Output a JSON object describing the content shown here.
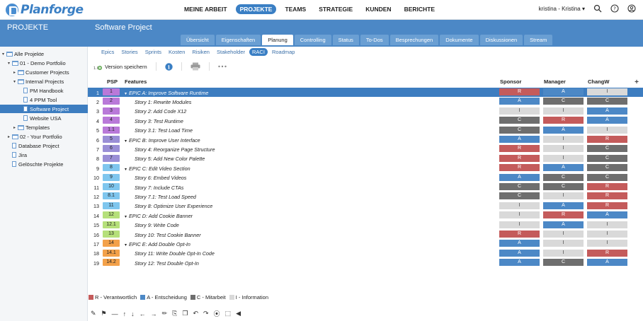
{
  "brand": {
    "name": "Planforge",
    "color": "#3a7fc4"
  },
  "mainnav": [
    "MEINE ARBEIT",
    "PROJEKTE",
    "TEAMS",
    "STRATEGIE",
    "KUNDEN",
    "BERICHTE"
  ],
  "mainnav_active": "PROJEKTE",
  "user": {
    "label": "kristina - Kristina ▾"
  },
  "topicons": [
    "search-icon",
    "help-icon",
    "user-icon"
  ],
  "sidebar": {
    "title": "PROJEKTE",
    "items": [
      {
        "label": "Alle Projekte",
        "type": "folder",
        "depth": 0,
        "caret": "▾"
      },
      {
        "label": "01 - Demo Portfolio",
        "type": "folder",
        "depth": 1,
        "caret": "▾"
      },
      {
        "label": "Customer Projects",
        "type": "folder",
        "depth": 2,
        "caret": "▸"
      },
      {
        "label": "Internal Projects",
        "type": "folder",
        "depth": 2,
        "caret": "▾"
      },
      {
        "label": "PM Handbook",
        "type": "doc",
        "depth": 3,
        "caret": ""
      },
      {
        "label": "4 PPM Tool",
        "type": "doc",
        "depth": 3,
        "caret": ""
      },
      {
        "label": "Software Project",
        "type": "doc",
        "depth": 3,
        "caret": "",
        "selected": true
      },
      {
        "label": "Website USA",
        "type": "doc",
        "depth": 3,
        "caret": ""
      },
      {
        "label": "Templates",
        "type": "folder",
        "depth": 2,
        "caret": "▸"
      },
      {
        "label": "02 - Your Portfolio",
        "type": "folder",
        "depth": 1,
        "caret": "▸"
      },
      {
        "label": "Database Project",
        "type": "doc",
        "depth": 1,
        "caret": ""
      },
      {
        "label": "Jira",
        "type": "doc",
        "depth": 1,
        "caret": ""
      },
      {
        "label": "Gelöschte Projekte",
        "type": "doc",
        "depth": 1,
        "caret": ""
      }
    ]
  },
  "project": {
    "title": "Software Project",
    "tabs": [
      "Übersicht",
      "Eigenschaften",
      "Planung",
      "Controlling",
      "Status",
      "To-Dos",
      "Besprechungen",
      "Dokumente",
      "Diskussionen",
      "Stream"
    ],
    "active_tab": "Planung",
    "subtabs": [
      "Epics",
      "Stories",
      "Sprints",
      "Kosten",
      "Risiken",
      "Stakeholder",
      "RACI",
      "Roadmap"
    ],
    "active_subtab": "RACI"
  },
  "toolbar": {
    "version_label": "Version speichern",
    "version_badge": "1.0"
  },
  "table": {
    "headers": {
      "psp": "PSP",
      "features": "Features",
      "sponsor": "Sponsor",
      "manager": "Manager",
      "changw": "ChangW"
    },
    "rows": [
      {
        "n": "1",
        "psp": "1",
        "c": "#b979d9",
        "f": "EPIC A: Improve Software Runtime",
        "epic": true,
        "s": "R",
        "m": "A",
        "w": "I",
        "selected": true
      },
      {
        "n": "2",
        "psp": "2",
        "c": "#b979d9",
        "f": "Story 1: Rewrite Modules",
        "s": "A",
        "m": "C",
        "w": "C"
      },
      {
        "n": "3",
        "psp": "3",
        "c": "#b979d9",
        "f": "Story 2: Add Code X12",
        "s": "I",
        "m": "I",
        "w": "A"
      },
      {
        "n": "4",
        "psp": "4",
        "c": "#b979d9",
        "f": "Story 3: Test Runtime",
        "s": "C",
        "m": "R",
        "w": "A"
      },
      {
        "n": "5",
        "psp": "1.1",
        "c": "#b979d9",
        "f": "Story 3.1: Test Load Time",
        "s": "C",
        "m": "A",
        "w": "I"
      },
      {
        "n": "6",
        "psp": "5",
        "c": "#9a8fd6",
        "f": "EPIC B: Improve User Interface",
        "epic": true,
        "s": "A",
        "m": "I",
        "w": "R"
      },
      {
        "n": "7",
        "psp": "6",
        "c": "#9a8fd6",
        "f": "Story 4: Reorganize Page Structure",
        "s": "R",
        "m": "I",
        "w": "C"
      },
      {
        "n": "8",
        "psp": "7",
        "c": "#9a8fd6",
        "f": "Story 5: Add New Color Palette",
        "s": "R",
        "m": "I",
        "w": "C"
      },
      {
        "n": "9",
        "psp": "8",
        "c": "#7fc6ee",
        "f": "EPIC C: Edit Video Section",
        "epic": true,
        "s": "R",
        "m": "A",
        "w": "C"
      },
      {
        "n": "10",
        "psp": "9",
        "c": "#7fc6ee",
        "f": "Story 6: Embed Videos",
        "s": "A",
        "m": "C",
        "w": "C"
      },
      {
        "n": "11",
        "psp": "10",
        "c": "#7fc6ee",
        "f": "Story 7: Include CTAs",
        "s": "C",
        "m": "C",
        "w": "R"
      },
      {
        "n": "12",
        "psp": "8.1",
        "c": "#7fc6ee",
        "f": "Story 7.1: Test Load Speed",
        "s": "C",
        "m": "I",
        "w": "R"
      },
      {
        "n": "13",
        "psp": "11",
        "c": "#7fc6ee",
        "f": "Story 8: Optimize User Experience",
        "s": "I",
        "m": "A",
        "w": "R"
      },
      {
        "n": "14",
        "psp": "12",
        "c": "#b6e07a",
        "f": "EPIC D: Add Cookie Banner",
        "epic": true,
        "s": "I",
        "m": "R",
        "w": "A"
      },
      {
        "n": "15",
        "psp": "12.1",
        "c": "#b6e07a",
        "f": "Story 9: Write Code",
        "s": "I",
        "m": "A",
        "w": "I"
      },
      {
        "n": "16",
        "psp": "13",
        "c": "#b6e07a",
        "f": "Story 10: Test Cookie Banner",
        "s": "R",
        "m": "I",
        "w": "I"
      },
      {
        "n": "17",
        "psp": "14",
        "c": "#f3a14a",
        "f": "EPIC E: Add Double Opt-In",
        "epic": true,
        "s": "A",
        "m": "I",
        "w": "I"
      },
      {
        "n": "18",
        "psp": "14.1",
        "c": "#f3a14a",
        "f": "Story 11: Write Double Opt-In Code",
        "s": "A",
        "m": "I",
        "w": "R"
      },
      {
        "n": "19",
        "psp": "14.2",
        "c": "#f3a14a",
        "f": "Story 12: Test Double Opt-In",
        "s": "A",
        "m": "C",
        "w": "A"
      }
    ]
  },
  "legend": [
    {
      "code": "R",
      "label": "R - Verantwortlich",
      "color": "#c45b5b"
    },
    {
      "code": "A",
      "label": "A - Entscheidung",
      "color": "#4c88c6"
    },
    {
      "code": "C",
      "label": "C - Mitarbeit",
      "color": "#6e6e6e"
    },
    {
      "code": "I",
      "label": "I - Information",
      "color": "#d9d9d9"
    }
  ],
  "bottom_tools": [
    "add-row-icon",
    "add-epic-icon",
    "remove-icon",
    "move-up-icon",
    "move-down-icon",
    "move-left-icon",
    "move-right-icon",
    "edit-icon",
    "copy-icon",
    "paste-icon",
    "undo-icon",
    "redo-icon",
    "link-icon",
    "crop-icon",
    "send-icon"
  ]
}
